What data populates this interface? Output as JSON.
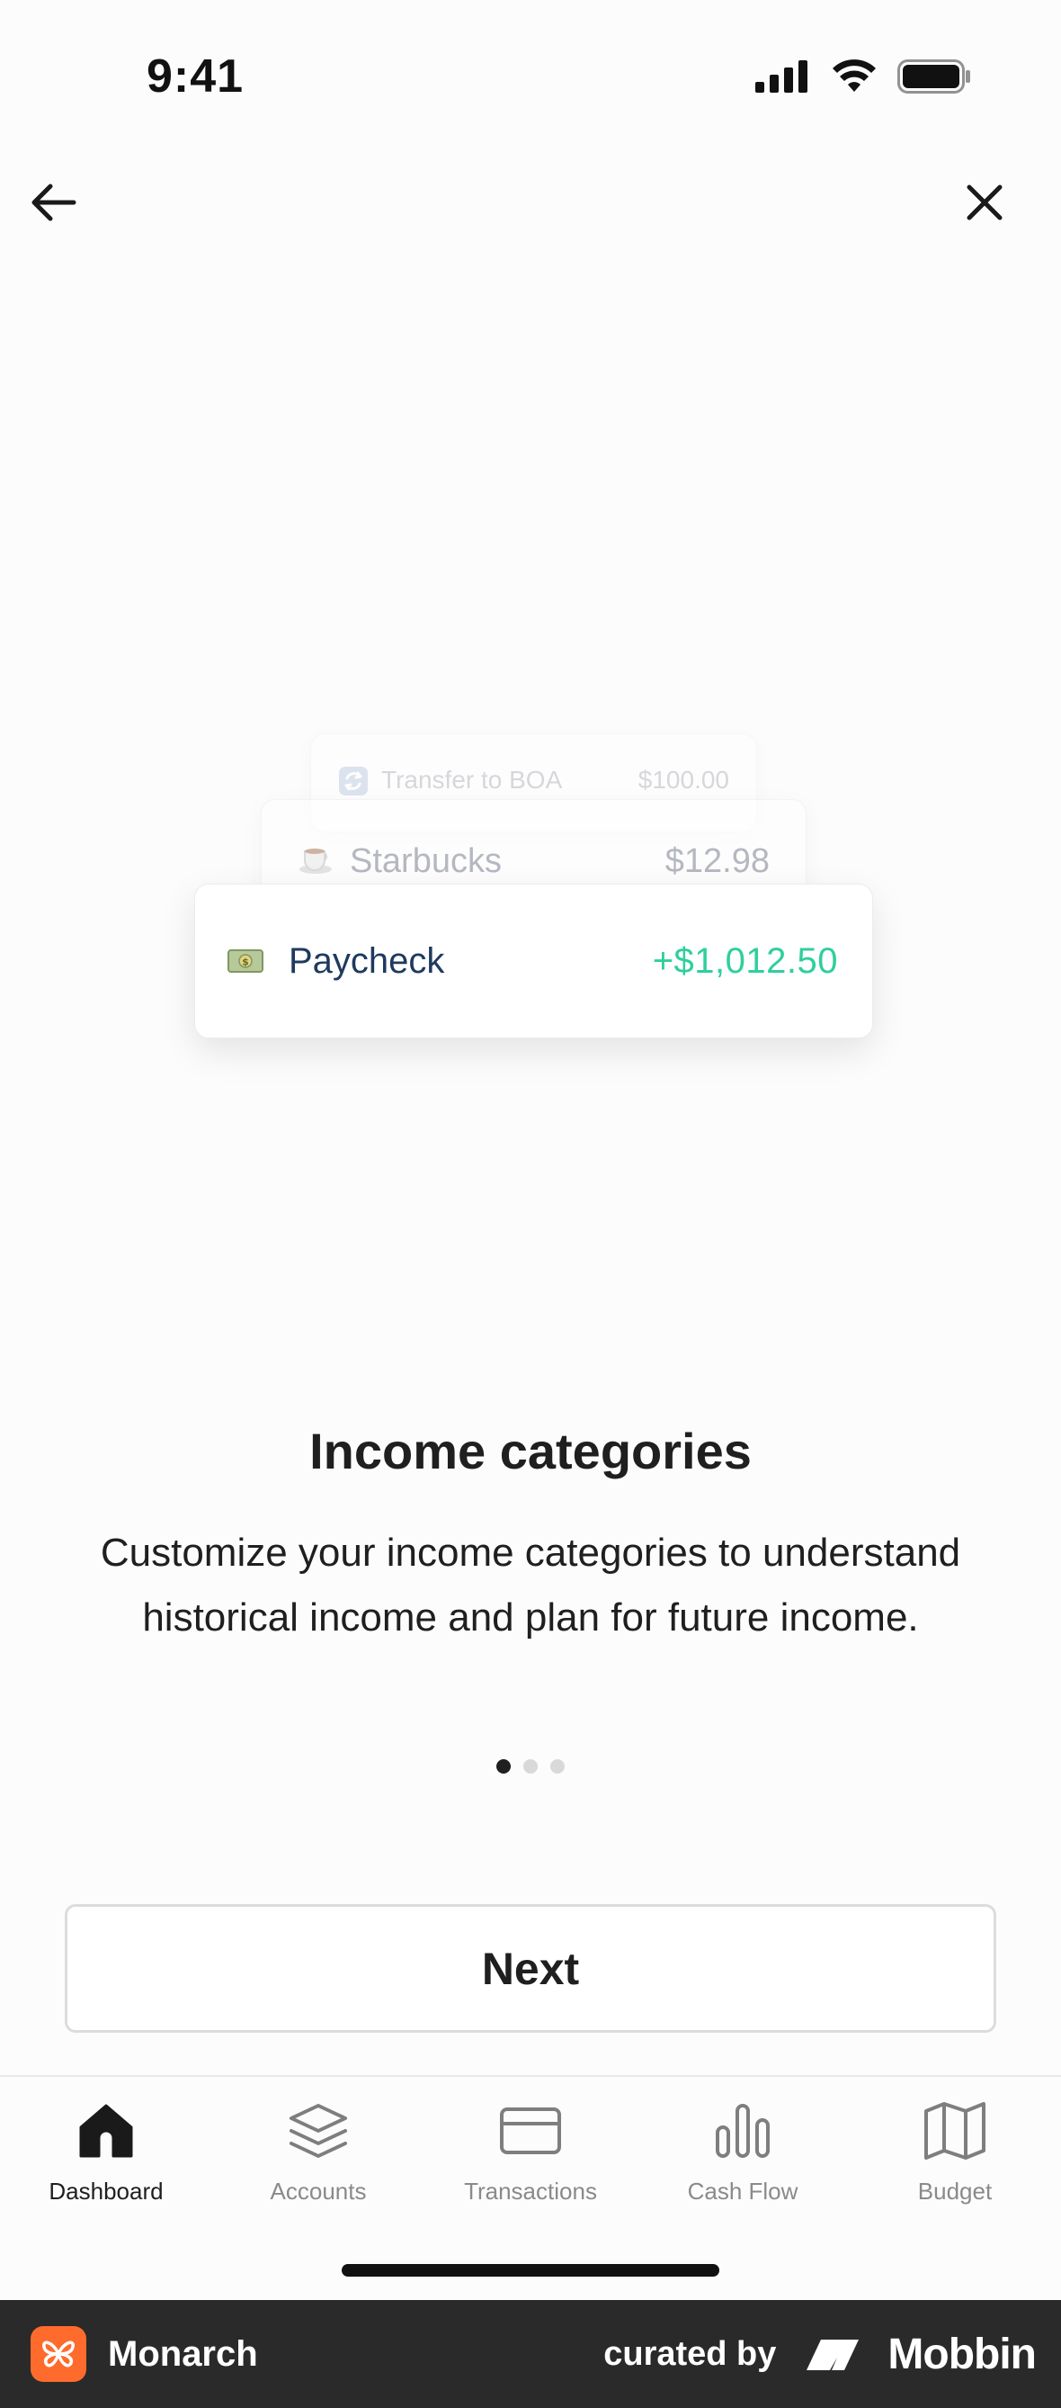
{
  "status_bar": {
    "time": "9:41"
  },
  "illustration": {
    "cards": [
      {
        "label": "Transfer to BOA",
        "amount": "$100.00",
        "icon": "transfer-icon"
      },
      {
        "label": "Starbucks",
        "amount": "$12.98",
        "icon": "coffee-icon"
      },
      {
        "label": "Paycheck",
        "amount": "+$1,012.50",
        "icon": "money-icon"
      }
    ]
  },
  "content": {
    "title": "Income categories",
    "description": "Customize your income categories to understand historical income and plan for future income."
  },
  "pager": {
    "total": 3,
    "current": 1
  },
  "next_button": {
    "label": "Next"
  },
  "tabbar": {
    "items": [
      {
        "label": "Dashboard",
        "icon": "home-icon"
      },
      {
        "label": "Accounts",
        "icon": "layers-icon"
      },
      {
        "label": "Transactions",
        "icon": "credit-card-icon"
      },
      {
        "label": "Cash Flow",
        "icon": "bar-chart-icon"
      },
      {
        "label": "Budget",
        "icon": "map-icon"
      }
    ]
  },
  "footer": {
    "brand": "Monarch",
    "curated": "curated by",
    "mobbin": "Mobbin"
  },
  "colors": {
    "income_green": "#2fcf9d",
    "brand_orange": "#ff6b2c"
  }
}
